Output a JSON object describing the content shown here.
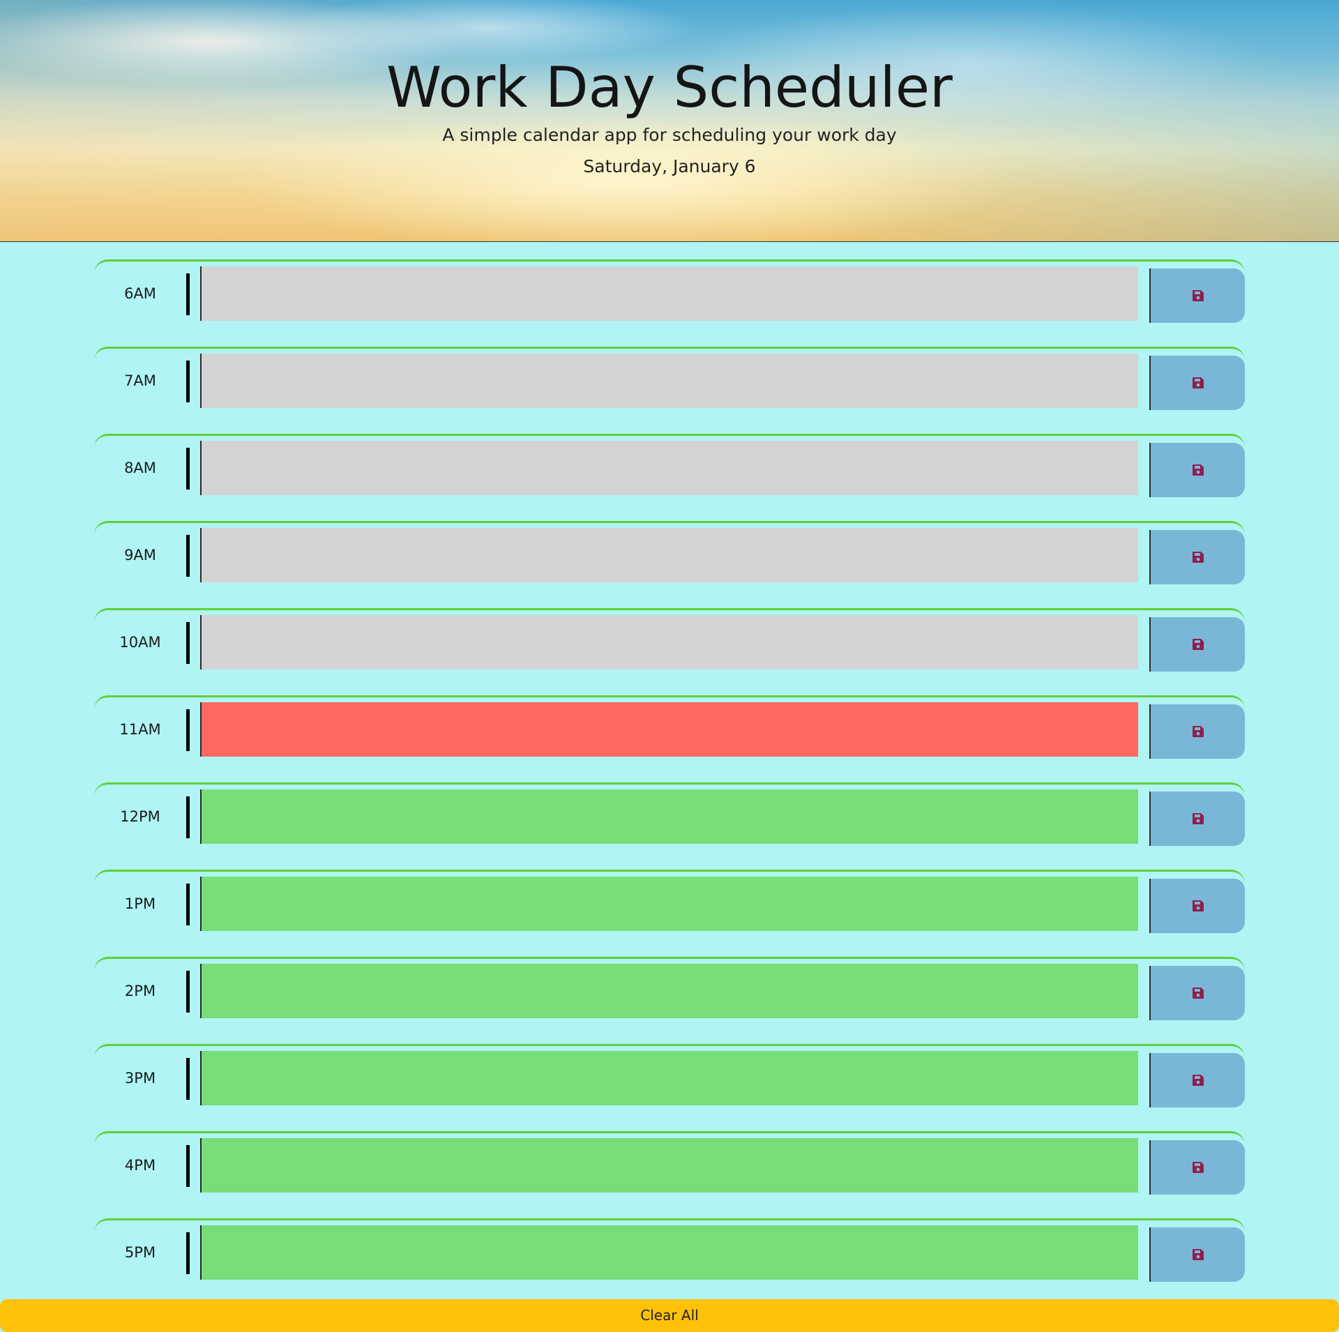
{
  "header": {
    "title": "Work Day Scheduler",
    "subtitle": "A simple calendar app for scheduling your work day",
    "date": "Saturday, January 6"
  },
  "time_blocks": [
    {
      "hour": "6AM",
      "status": "past",
      "text": ""
    },
    {
      "hour": "7AM",
      "status": "past",
      "text": ""
    },
    {
      "hour": "8AM",
      "status": "past",
      "text": ""
    },
    {
      "hour": "9AM",
      "status": "past",
      "text": ""
    },
    {
      "hour": "10AM",
      "status": "past",
      "text": ""
    },
    {
      "hour": "11AM",
      "status": "present",
      "text": ""
    },
    {
      "hour": "12PM",
      "status": "future",
      "text": ""
    },
    {
      "hour": "1PM",
      "status": "future",
      "text": ""
    },
    {
      "hour": "2PM",
      "status": "future",
      "text": ""
    },
    {
      "hour": "3PM",
      "status": "future",
      "text": ""
    },
    {
      "hour": "4PM",
      "status": "future",
      "text": ""
    },
    {
      "hour": "5PM",
      "status": "future",
      "text": ""
    }
  ],
  "save_icon": "floppy-disk-icon",
  "clear_button": {
    "label": "Clear All"
  },
  "colors": {
    "page_background": "#b0f4f4",
    "past": "#d3d3d3",
    "present": "#ff6961",
    "future": "#77dd77",
    "save_button": "#7ab7d6",
    "save_icon": "#8f1d4e",
    "row_border": "#5fd039",
    "clear_button": "#ffc10a"
  }
}
